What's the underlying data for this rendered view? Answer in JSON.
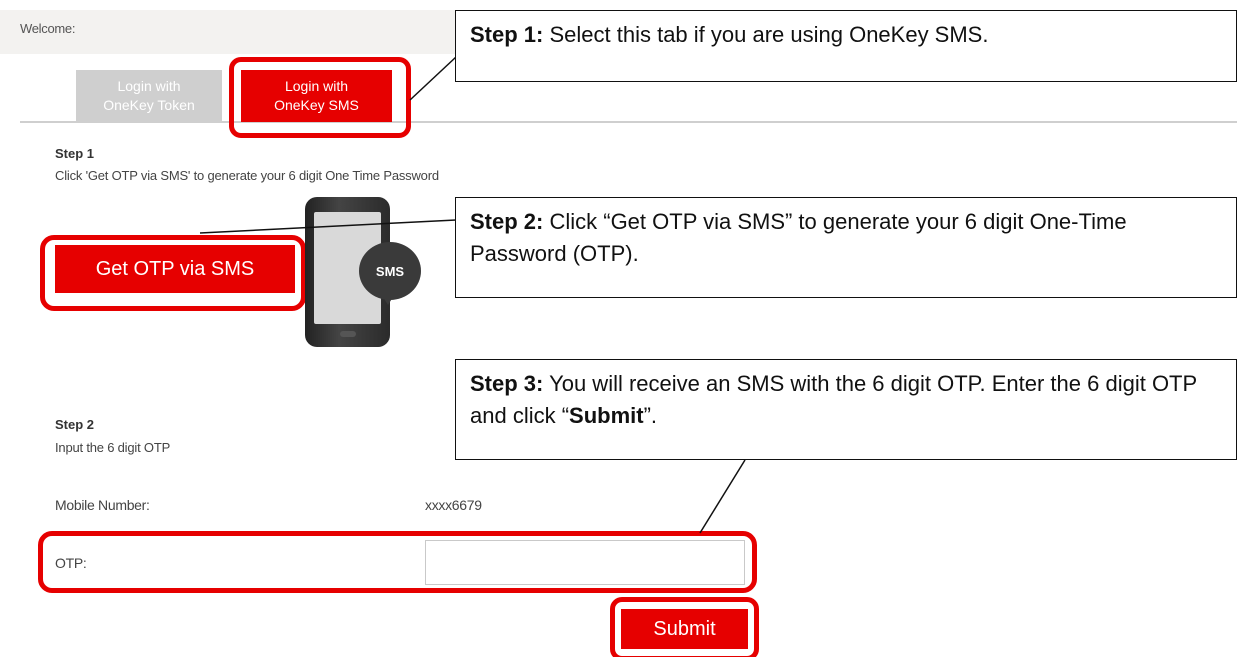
{
  "header": {
    "welcome": "Welcome:"
  },
  "tabs": [
    {
      "label_line1": "Login with",
      "label_line2": "OneKey Token",
      "active": false
    },
    {
      "label_line1": "Login with",
      "label_line2": "OneKey SMS",
      "active": true
    }
  ],
  "step1": {
    "heading": "Step 1",
    "text": "Click 'Get OTP via SMS' to generate your 6 digit One Time Password",
    "button_label": "Get OTP via SMS",
    "bubble_label": "SMS"
  },
  "step2": {
    "heading": "Step 2",
    "text": "Input the 6 digit OTP"
  },
  "form": {
    "mobile_label": "Mobile Number:",
    "mobile_value": "xxxx6679",
    "otp_label": "OTP:",
    "otp_value": "",
    "submit_label": "Submit"
  },
  "callouts": {
    "c1_bold": "Step 1:",
    "c1_text": " Select this tab if you are using OneKey SMS.",
    "c2_bold": "Step 2:",
    "c2_text": " Click “Get OTP via SMS” to generate your 6 digit One-Time Password (OTP).",
    "c3_bold": "Step 3:",
    "c3_text1": " You will receive an SMS with the 6 digit OTP. Enter the 6 digit OTP and click “",
    "c3_bold2": "Submit",
    "c3_text2": "”."
  },
  "colors": {
    "brand_red": "#e60000",
    "tab_inactive": "#cfcfcf"
  }
}
